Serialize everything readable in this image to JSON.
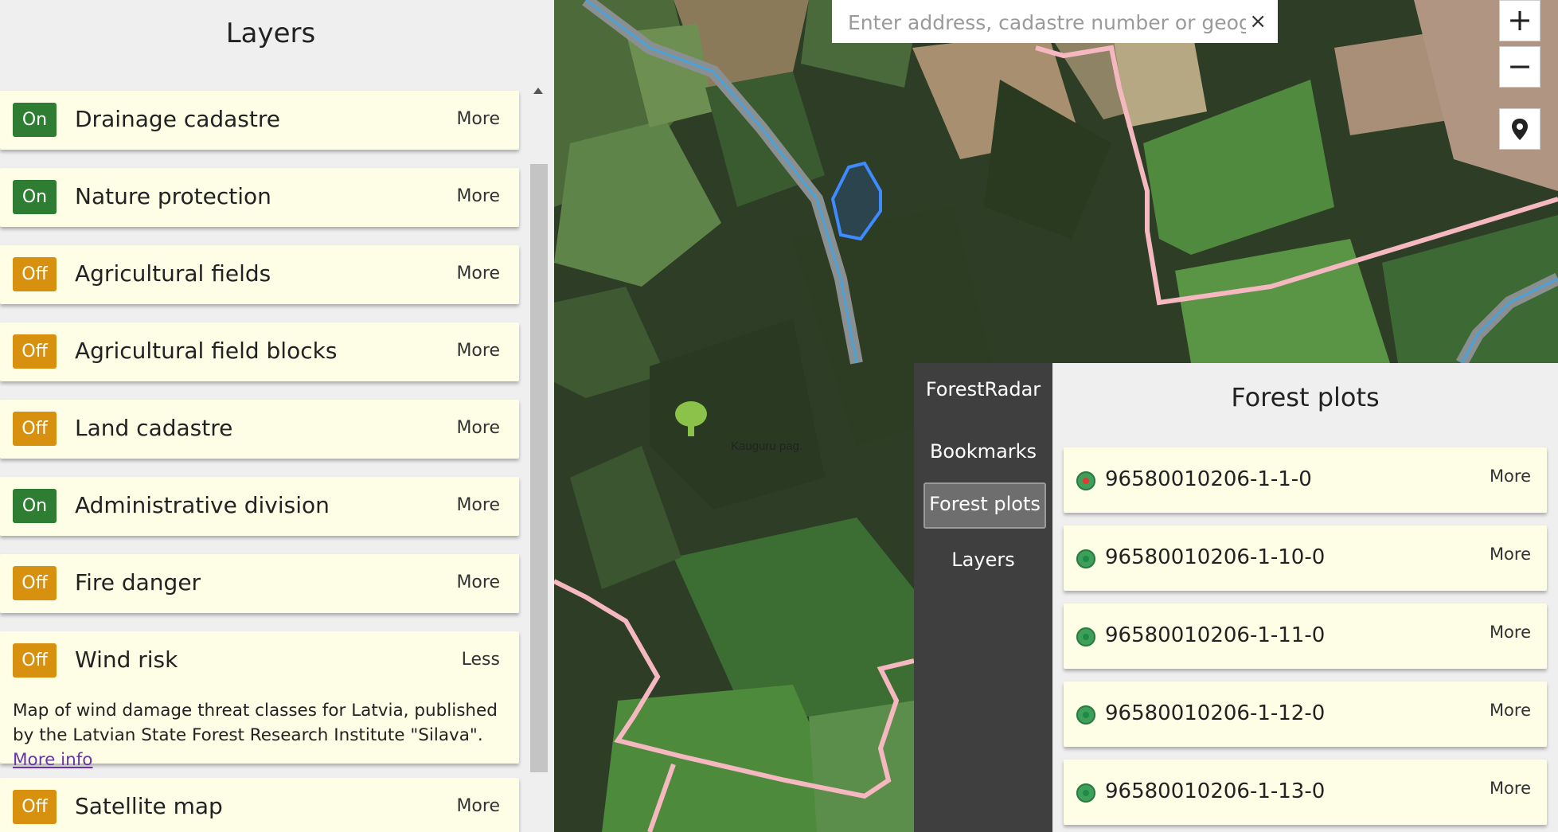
{
  "layers_panel": {
    "title": "Layers",
    "layers": [
      {
        "state": "On",
        "name": "Drainage cadastre",
        "action": "More"
      },
      {
        "state": "On",
        "name": "Nature protection",
        "action": "More"
      },
      {
        "state": "Off",
        "name": "Agricultural fields",
        "action": "More"
      },
      {
        "state": "Off",
        "name": "Agricultural field blocks",
        "action": "More"
      },
      {
        "state": "Off",
        "name": "Land cadastre",
        "action": "More"
      },
      {
        "state": "On",
        "name": "Administrative division",
        "action": "More"
      },
      {
        "state": "Off",
        "name": "Fire danger",
        "action": "More"
      },
      {
        "state": "Off",
        "name": "Wind risk",
        "action": "Less",
        "description": "Map of wind damage threat classes for Latvia, published by the Latvian State Forest Research Institute \"Silava\". ",
        "link": "More info"
      },
      {
        "state": "Off",
        "name": "Satellite map",
        "action": "More"
      }
    ]
  },
  "map": {
    "search_placeholder": "Enter address, cadastre number or geographic",
    "clear_label": "×",
    "zoom_in_label": "+",
    "zoom_out_label": "−",
    "place_label": "Kauguru pag."
  },
  "nav": {
    "items": [
      "ForestRadar",
      "Bookmarks",
      "Forest plots",
      "Layers"
    ],
    "active": "Forest plots"
  },
  "plots_panel": {
    "title": "Forest plots",
    "plots": [
      {
        "id": "96580010206-1-1-0",
        "action": "More",
        "selected": true
      },
      {
        "id": "96580010206-1-10-0",
        "action": "More"
      },
      {
        "id": "96580010206-1-11-0",
        "action": "More"
      },
      {
        "id": "96580010206-1-12-0",
        "action": "More"
      },
      {
        "id": "96580010206-1-13-0",
        "action": "More"
      }
    ]
  },
  "colors": {
    "toggle_on": "#2e7d32",
    "toggle_off": "#d8900f",
    "card_bg": "#fefee6",
    "boundary_pink": "#f6b8c0",
    "river_blue": "#4aa3d8",
    "plot_outline": "#3d8bff"
  }
}
